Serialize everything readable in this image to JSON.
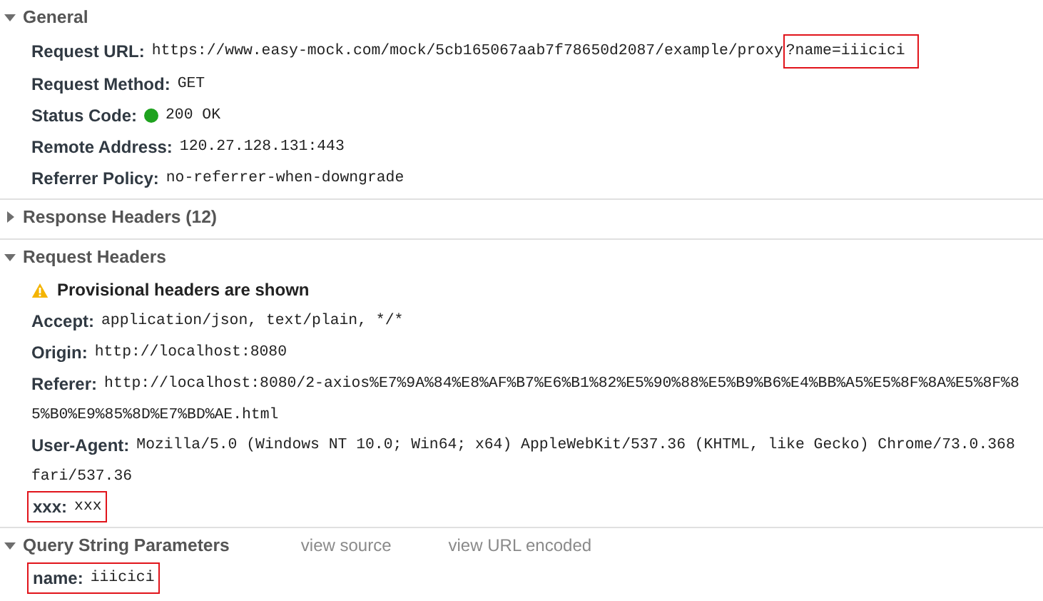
{
  "sections": [
    {
      "title": "General",
      "expanded": true,
      "items": [
        {
          "kind": "header",
          "name": "Request URL:",
          "value": "https://www.easy-mock.com/mock/5cb165067aab7f78650d2087/example/proxy",
          "marked_suffix": "?name=iiicici",
          "highlighted": false
        },
        {
          "kind": "header",
          "name": "Request Method:",
          "value": "GET",
          "highlighted": false
        },
        {
          "kind": "status",
          "name": "Status Code:",
          "value": "200 OK",
          "highlighted": false
        },
        {
          "kind": "header",
          "name": "Remote Address:",
          "value": "120.27.128.131:443",
          "highlighted": false
        },
        {
          "kind": "header",
          "name": "Referrer Policy:",
          "value": "no-referrer-when-downgrade",
          "highlighted": false
        }
      ]
    },
    {
      "title": "Response Headers",
      "count": "(12)",
      "expanded": false
    },
    {
      "title": "Request Headers",
      "expanded": true,
      "notice": "Provisional headers are shown",
      "items": [
        {
          "kind": "header",
          "name": "Accept:",
          "value": "application/json, text/plain, */*",
          "highlighted": false
        },
        {
          "kind": "header",
          "name": "Origin:",
          "value": "http://localhost:8080",
          "highlighted": false
        },
        {
          "kind": "header",
          "name": "Referer:",
          "value": "http://localhost:8080/2-axios%E7%9A%84%E8%AF%B7%E6%B1%82%E5%90%88%E5%B9%B6%E4%BB%A5%E5%8F%8A%E5%8F%8",
          "continuation": "5%B0%E9%85%8D%E7%BD%AE.html",
          "highlighted": false
        },
        {
          "kind": "header",
          "name": "User-Agent:",
          "value": "Mozilla/5.0 (Windows NT 10.0; Win64; x64) AppleWebKit/537.36 (KHTML, like Gecko) Chrome/73.0.368",
          "continuation": "fari/537.36",
          "highlighted": false
        },
        {
          "kind": "header",
          "name": "xxx:",
          "value": "xxx",
          "highlighted": true
        }
      ]
    },
    {
      "title": "Query String Parameters",
      "expanded": true,
      "actions": [
        "view source",
        "view URL encoded"
      ],
      "items": [
        {
          "kind": "header",
          "name": "name:",
          "value": "iiicici",
          "highlighted": true
        }
      ]
    }
  ]
}
